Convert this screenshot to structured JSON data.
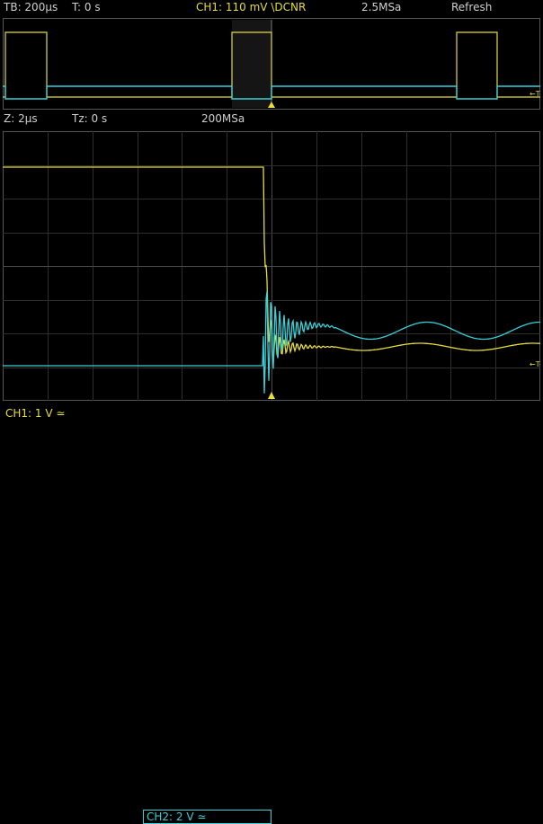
{
  "top_bar": {
    "timebase": "TB: 200µs",
    "trigger_time": "T: 0 s",
    "ch1_trigger": "CH1: 110 mV \\DCNR",
    "sample_rate": "2.5MSa",
    "acquire_mode": "Refresh"
  },
  "zoom_bar": {
    "zoom_timebase": "Z: 2µs",
    "zoom_time": "Tz: 0 s",
    "zoom_sample_rate": "200MSa"
  },
  "bottom_bar": {
    "ch1_scale": "CH1: 1 V ≃",
    "ch2_scale": "CH2: 2 V ≃"
  },
  "trigger_marker_label": "←T-",
  "colors": {
    "ch1": "#e6dc3a",
    "ch2": "#3ad0d8",
    "grid": "#3a3a3a",
    "background": "#000000"
  }
}
